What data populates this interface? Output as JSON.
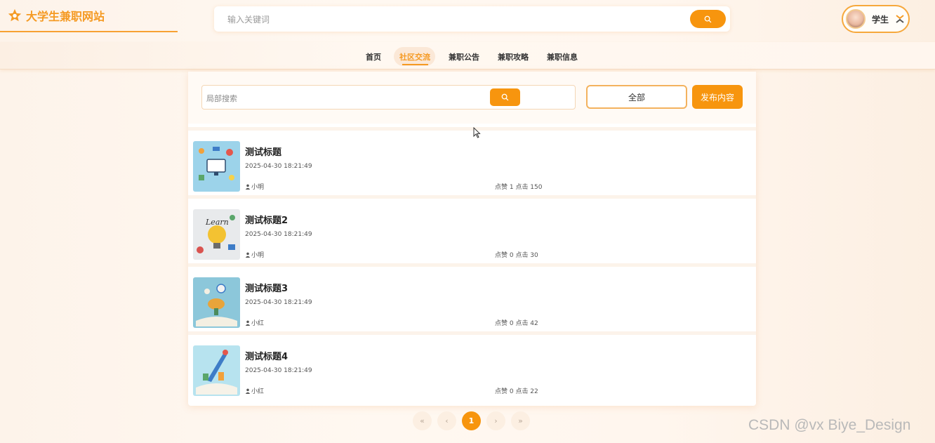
{
  "header": {
    "site_title": "大学生兼职网站",
    "search_placeholder": "输入关键词",
    "user_name": "学生"
  },
  "nav": {
    "items": [
      {
        "label": "首页"
      },
      {
        "label": "社区交流",
        "active": true
      },
      {
        "label": "兼职公告"
      },
      {
        "label": "兼职攻略"
      },
      {
        "label": "兼职信息"
      }
    ]
  },
  "filters": {
    "local_search_placeholder": "局部搜索",
    "all_label": "全部",
    "publish_label": "发布内容"
  },
  "posts": [
    {
      "title": "测试标题",
      "time": "2025-04-30 18:21:49",
      "author": "小明",
      "stats": "点赞 1 点击 150"
    },
    {
      "title": "测试标题2",
      "time": "2025-04-30 18:21:49",
      "author": "小明",
      "stats": "点赞 0 点击 30"
    },
    {
      "title": "测试标题3",
      "time": "2025-04-30 18:21:49",
      "author": "小红",
      "stats": "点赞 0 点击 42"
    },
    {
      "title": "测试标题4",
      "time": "2025-04-30 18:21:49",
      "author": "小红",
      "stats": "点赞 0 点击 22"
    }
  ],
  "pagination": {
    "first": "«",
    "prev": "‹",
    "current": "1",
    "next": "›",
    "last": "»"
  },
  "watermark": "CSDN @vx Biye_Design",
  "colors": {
    "accent": "#f7950e",
    "title_orange": "#f59a23",
    "background": "#fff8f1"
  },
  "icons": {
    "logo": "star-icon",
    "search": "search-icon",
    "user_menu": "swap-icon",
    "author": "person-icon"
  }
}
